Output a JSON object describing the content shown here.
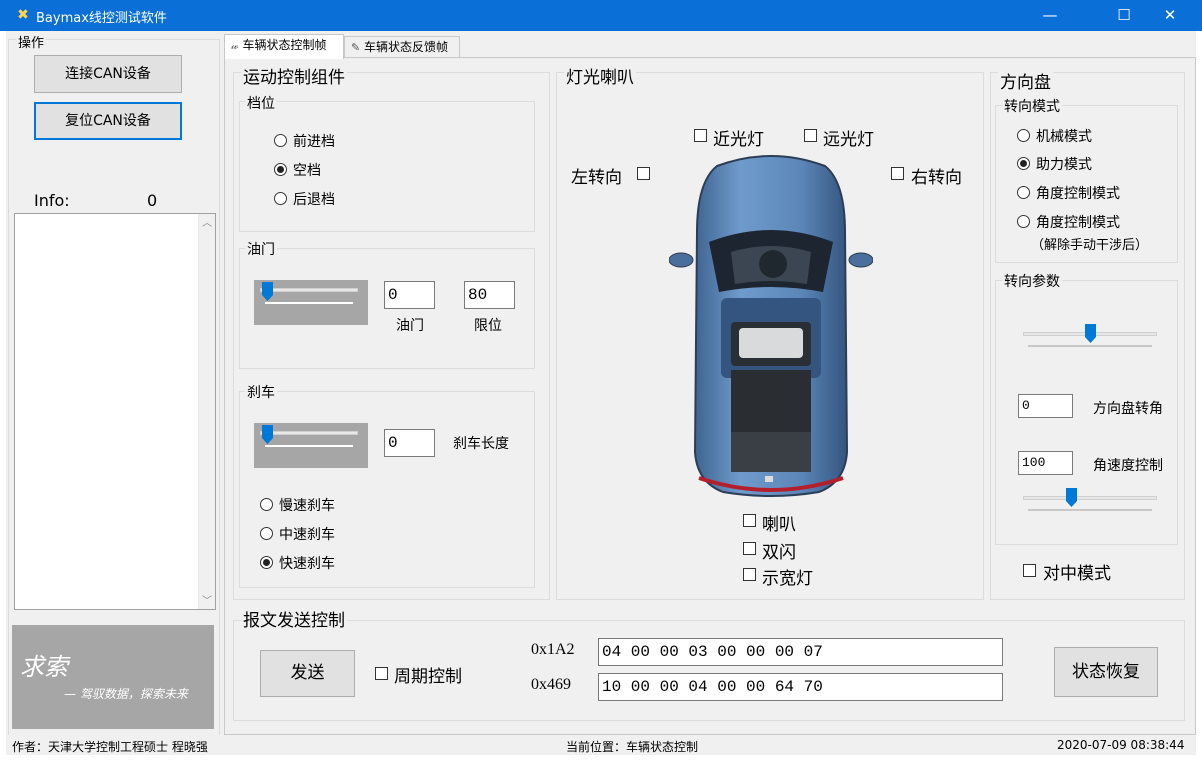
{
  "window": {
    "title": "Baymax线控测试软件",
    "icon": "tools-icon",
    "min_glyph": "—",
    "max_glyph": "☐",
    "close_glyph": "✕"
  },
  "left": {
    "group_title": "操作",
    "connect_label": "连接CAN设备",
    "reset_label": "复位CAN设备",
    "info_label": "Info:",
    "info_value": "0",
    "logo_title": "求索",
    "logo_slogan": "— 驾驭数据，探索未来"
  },
  "tabs": [
    {
      "label": "车辆状态控制帧",
      "icon": "tools-icon"
    },
    {
      "label": "车辆状态反馈帧",
      "icon": "pencil-icon"
    }
  ],
  "motion": {
    "title": "运动控制组件",
    "gear": {
      "title": "档位",
      "options": [
        "前进档",
        "空档",
        "后退档"
      ],
      "selected": "空档"
    },
    "throttle": {
      "title": "油门",
      "value": "0",
      "limit": "80",
      "value_label": "油门",
      "limit_label": "限位",
      "slider_level": 0
    },
    "brake": {
      "title": "刹车",
      "value": "0",
      "length_label": "刹车长度",
      "slider_level": 0,
      "options": [
        "慢速刹车",
        "中速刹车",
        "快速刹车"
      ],
      "selected": "快速刹车"
    }
  },
  "lights": {
    "title": "灯光喇叭",
    "low_beam": "近光灯",
    "high_beam": "远光灯",
    "left_turn": "左转向",
    "right_turn": "右转向",
    "horn": "喇叭",
    "hazard": "双闪",
    "width_lamp": "示宽灯",
    "car_colors": {
      "body": "#5b86b8",
      "dark": "#2c3e55",
      "roof": "#27313d"
    }
  },
  "steering": {
    "title": "方向盘",
    "mode_title": "转向模式",
    "modes": [
      "机械模式",
      "助力模式",
      "角度控制模式",
      "角度控制模式"
    ],
    "mode_note": "（解除手动干涉后）",
    "selected": "助力模式",
    "param_title": "转向参数",
    "angle_value": "0",
    "angle_label": "方向盘转角",
    "speed_value": "100",
    "speed_label": "角速度控制",
    "angle_slider_level": 0.5,
    "speed_slider_level": 0.35,
    "center_mode": "对中模式"
  },
  "message": {
    "title": "报文发送控制",
    "send_label": "发送",
    "periodic_label": "周期控制",
    "id1": "0x1A2",
    "data1": "04 00 00 03 00 00 00 07",
    "id2": "0x469",
    "data2": "10 00 00 04 00 00 64 70",
    "restore_label": "状态恢复"
  },
  "status": {
    "author": "作者：天津大学控制工程硕士 程晓强",
    "location": "当前位置：车辆状态控制",
    "datetime": "2020-07-09 08:38:44"
  },
  "colors": {
    "titlebar": "#0a6fd6",
    "accent": "#0078d7",
    "panel": "#f0f0f0"
  }
}
